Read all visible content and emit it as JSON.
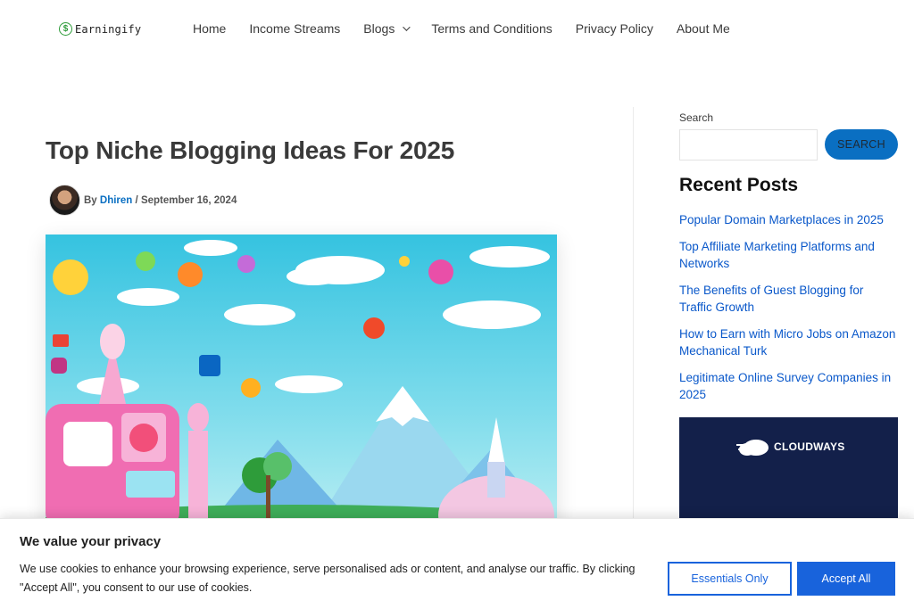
{
  "brand": {
    "name": "Earningify",
    "icon": "dollar-circle-icon",
    "accent": "#2e9c3a"
  },
  "nav": {
    "items": [
      {
        "label": "Home"
      },
      {
        "label": "Income Streams"
      },
      {
        "label": "Blogs",
        "icon": "chevron-down-icon"
      },
      {
        "label": "Terms and Conditions"
      },
      {
        "label": "Privacy Policy"
      },
      {
        "label": "About Me"
      }
    ]
  },
  "article": {
    "title": "Top Niche Blogging Ideas For 2025",
    "by": "By",
    "author": "Dhiren",
    "separator": "/",
    "date": "September 16, 2024"
  },
  "sidebar": {
    "search_label": "Search",
    "search_value": "",
    "search_button": "SEARCH",
    "recent_title": "Recent Posts",
    "recent_posts": [
      "Popular Domain Marketplaces in 2025",
      "Top Affiliate Marketing Platforms and Networks",
      "The Benefits of Guest Blogging for Traffic Growth",
      "How to Earn with Micro Jobs on Amazon Mechanical Turk",
      "Legitimate Online Survey Companies in 2025"
    ],
    "ad_brand": "CLOUDWAYS"
  },
  "cookie": {
    "title": "We value your privacy",
    "text": "We use cookies to enhance your browsing experience, serve personalised ads or content, and analyse our traffic. By clicking \"Accept All\", you consent to our use of cookies.",
    "essentials_button": "Essentials Only",
    "accept_button": "Accept All"
  },
  "colors": {
    "link": "#0a58ca",
    "primary_button": "#1863dc",
    "search_button": "#0a6fc2"
  }
}
